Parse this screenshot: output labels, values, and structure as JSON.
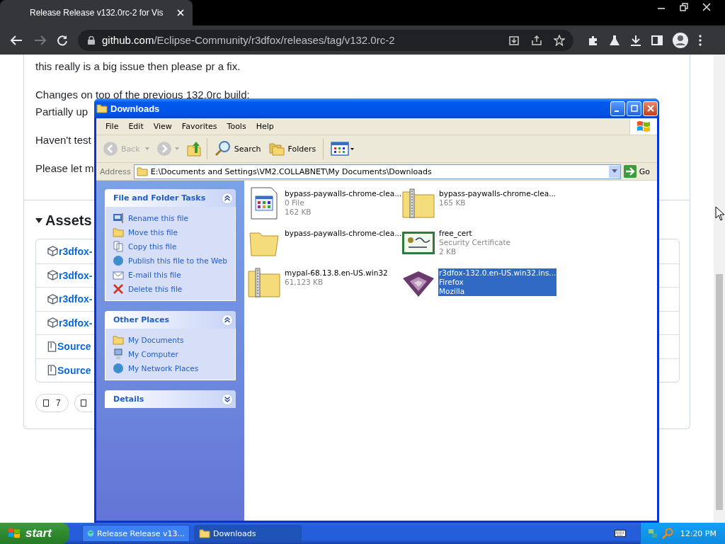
{
  "browser": {
    "tab": {
      "title": "Release Release v132.0rc-2 for Vis"
    },
    "url": {
      "host": "github.com",
      "path": "/Eclipse-Community/r3dfox/releases/tag/v132.0rc-2"
    }
  },
  "page": {
    "paragraphs": [
      [
        "this really is a big issue then please pr a fix."
      ],
      [
        "Changes on top of the previous 132.0rc build:",
        "Partially up"
      ],
      [
        "Haven't test"
      ],
      [
        "Please let m"
      ]
    ],
    "assets_heading": "Assets",
    "assets": [
      {
        "kind": "package",
        "name": "r3dfox-"
      },
      {
        "kind": "package",
        "name": "r3dfox-"
      },
      {
        "kind": "package",
        "name": "r3dfox-"
      },
      {
        "kind": "package",
        "name": "r3dfox-"
      },
      {
        "kind": "source",
        "name": "Source"
      },
      {
        "kind": "source",
        "name": "Source"
      }
    ],
    "reactions": [
      {
        "count": "7"
      }
    ]
  },
  "explorer": {
    "title": "Downloads",
    "menu": [
      "File",
      "Edit",
      "View",
      "Favorites",
      "Tools",
      "Help"
    ],
    "toolbar": {
      "back": "Back",
      "search": "Search",
      "folders": "Folders"
    },
    "address": {
      "label": "Address",
      "path": "E:\\Documents and Settings\\VM2.COLLABNET\\My Documents\\Downloads",
      "go": "Go"
    },
    "panels": [
      {
        "title": "File and Folder Tasks",
        "expanded": true,
        "items": [
          {
            "kind": "rename",
            "label": "Rename this file"
          },
          {
            "kind": "move",
            "label": "Move this file"
          },
          {
            "kind": "copy",
            "label": "Copy this file"
          },
          {
            "kind": "publish",
            "label": "Publish this file to the Web"
          },
          {
            "kind": "email",
            "label": "E-mail this file"
          },
          {
            "kind": "delete",
            "label": "Delete this file"
          }
        ]
      },
      {
        "title": "Other Places",
        "expanded": true,
        "items": [
          {
            "kind": "folder",
            "label": "My Documents"
          },
          {
            "kind": "computer",
            "label": "My Computer"
          },
          {
            "kind": "network",
            "label": "My Network Places"
          }
        ]
      },
      {
        "title": "Details",
        "expanded": false
      }
    ],
    "files": [
      {
        "kind": "app",
        "name": "bypass-paywalls-chrome-clea...",
        "lines": [
          "0 File",
          "162 KB"
        ],
        "selected": false
      },
      {
        "kind": "zip",
        "name": "bypass-paywalls-chrome-clea...",
        "lines": [
          "165 KB"
        ],
        "selected": false
      },
      {
        "kind": "folder",
        "name": "bypass-paywalls-chrome-clea...",
        "selected": false
      },
      {
        "kind": "cert",
        "name": "free_cert",
        "lines": [
          "Security Certificate",
          "2 KB"
        ],
        "selected": false
      },
      {
        "kind": "zip",
        "name": "mypal-68.13.8.en-US.win32",
        "lines": [
          "61,123 KB"
        ],
        "selected": false
      },
      {
        "kind": "installer",
        "name": "r3dfox-132.0.en-US.win32.ins...",
        "lines": [
          "Firefox",
          "Mozilla"
        ],
        "selected": true
      }
    ]
  },
  "taskbar": {
    "start": "start",
    "tasks": [
      {
        "kind": "browser",
        "label": "Release Release v13...",
        "selected": false
      },
      {
        "kind": "folder",
        "label": "Downloads",
        "selected": true
      }
    ],
    "clock": "12:20 PM"
  }
}
